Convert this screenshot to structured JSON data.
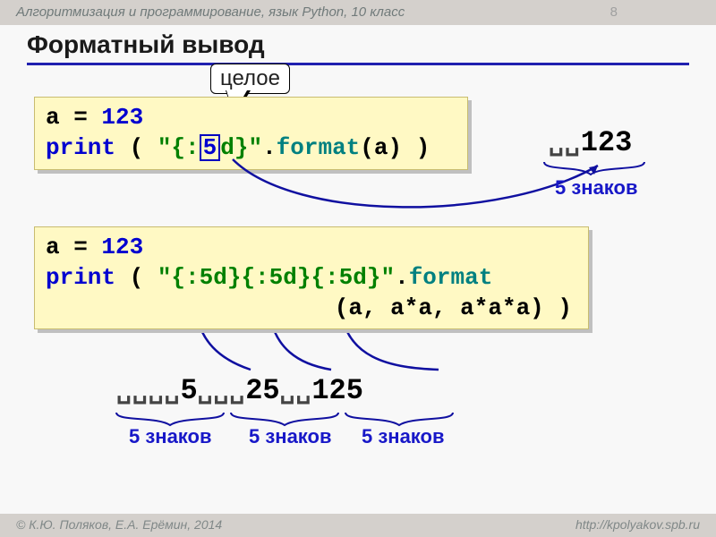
{
  "header": {
    "breadcrumb": "Алгоритмизация и программирование, язык Python, 10 класс",
    "page_number": "8"
  },
  "title": "Форматный вывод",
  "callout": "целое",
  "code1": {
    "line1_a": "a = ",
    "line1_b": "123",
    "line2_print": " print",
    "line2_a": " ( ",
    "line2_fmt_open": "\"{:",
    "line2_five": "5",
    "line2_fmt_close": "d}\"",
    "line2_dot": ".",
    "line2_format": "format",
    "line2_args": "(a) )"
  },
  "output1": {
    "pad": "␣␣",
    "val": "123"
  },
  "label_5chars": "5 знаков",
  "code2": {
    "line1_a": "a = ",
    "line1_b": "123",
    "line2_print": " print",
    "line2_a": " ( ",
    "line2_fmt": "\"{:5d}{:5d}{:5d}\"",
    "line2_dot": ".",
    "line2_format": "format",
    "line3_args": "(a, a*a, a*a*a) )"
  },
  "output2": {
    "g1_pad": "␣␣␣␣",
    "g1_val": "5",
    "g2_pad": "␣␣␣",
    "g2_val": "25",
    "g3_pad": "␣␣",
    "g3_val": "125"
  },
  "footer": {
    "left": "© К.Ю. Поляков, Е.А. Ерёмин, 2014",
    "right": "http://kpolyakov.spb.ru"
  }
}
